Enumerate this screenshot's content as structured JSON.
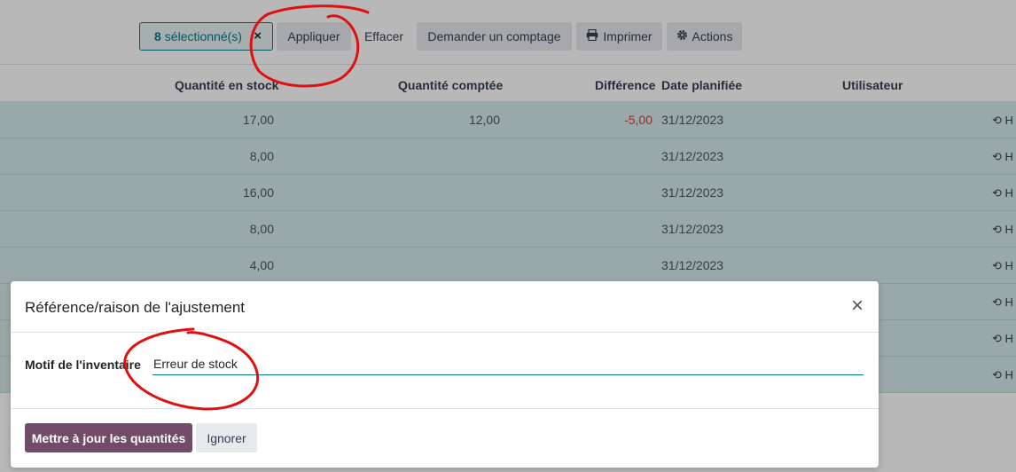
{
  "toolbar": {
    "selected_count": "8",
    "selected_label": "sélectionné(s)",
    "clear_selection_glyph": "×",
    "apply": "Appliquer",
    "clear": "Effacer",
    "request_count": "Demander un comptage",
    "print": "Imprimer",
    "actions": "Actions"
  },
  "table": {
    "headers": {
      "quantity_in_stock": "Quantité en stock",
      "counted_quantity": "Quantité comptée",
      "difference": "Différence",
      "scheduled_date": "Date planifiée",
      "user": "Utilisateur"
    },
    "rows": [
      {
        "stock": "17,00",
        "counted": "12,00",
        "difference": "-5,00",
        "date": "31/12/2023",
        "history": "H"
      },
      {
        "stock": "8,00",
        "counted": "",
        "difference": "",
        "date": "31/12/2023",
        "history": "H"
      },
      {
        "stock": "16,00",
        "counted": "",
        "difference": "",
        "date": "31/12/2023",
        "history": "H"
      },
      {
        "stock": "8,00",
        "counted": "",
        "difference": "",
        "date": "31/12/2023",
        "history": "H"
      },
      {
        "stock": "4,00",
        "counted": "",
        "difference": "",
        "date": "31/12/2023",
        "history": "H"
      },
      {
        "stock": "",
        "counted": "",
        "difference": "",
        "date": "",
        "history": "H"
      },
      {
        "stock": "",
        "counted": "",
        "difference": "",
        "date": "",
        "history": "H"
      },
      {
        "stock": "",
        "counted": "",
        "difference": "",
        "date": "",
        "history": "H"
      }
    ]
  },
  "modal": {
    "title": "Référence/raison de l'ajustement",
    "close_glyph": "×",
    "field_label": "Motif de l'inventaire",
    "field_value": "Erreur de stock",
    "primary_button": "Mettre à jour les quantités",
    "secondary_button": "Ignorer"
  },
  "colors": {
    "primary": "#714b67",
    "accent": "#017e84",
    "selected_row": "#d5e9ea",
    "negative": "#d23f3a",
    "annotation": "#e01010"
  },
  "icons": {
    "print": "printer-icon",
    "actions": "gear-icon",
    "history": "history-icon",
    "close": "close-icon"
  }
}
